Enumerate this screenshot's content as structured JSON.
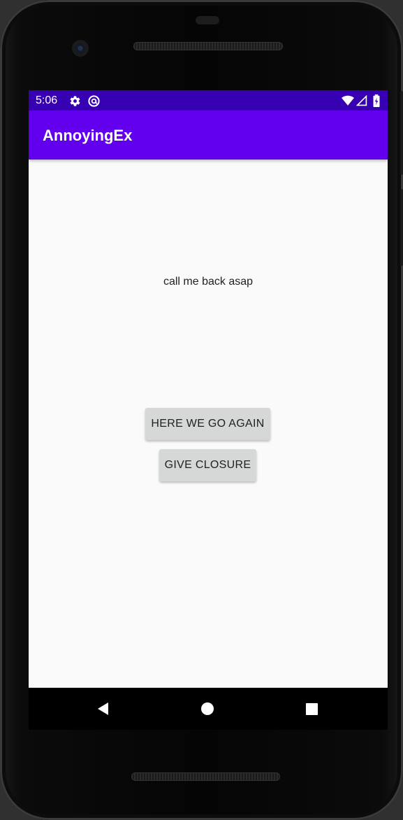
{
  "status_bar": {
    "time": "5:06",
    "background": "#3700b3",
    "left_icons": [
      "settings-gear-icon",
      "at-sign-icon"
    ],
    "right_icons": [
      "wifi-icon",
      "cell-signal-icon",
      "battery-icon"
    ]
  },
  "app_bar": {
    "title": "AnnoyingEx",
    "background": "#6200ee"
  },
  "content": {
    "message": "call me back asap",
    "buttons": [
      {
        "label": "HERE WE GO AGAIN"
      },
      {
        "label": "GIVE CLOSURE"
      }
    ]
  },
  "nav_bar": {
    "items": [
      "back-triangle-icon",
      "home-circle-icon",
      "recents-square-icon"
    ]
  }
}
